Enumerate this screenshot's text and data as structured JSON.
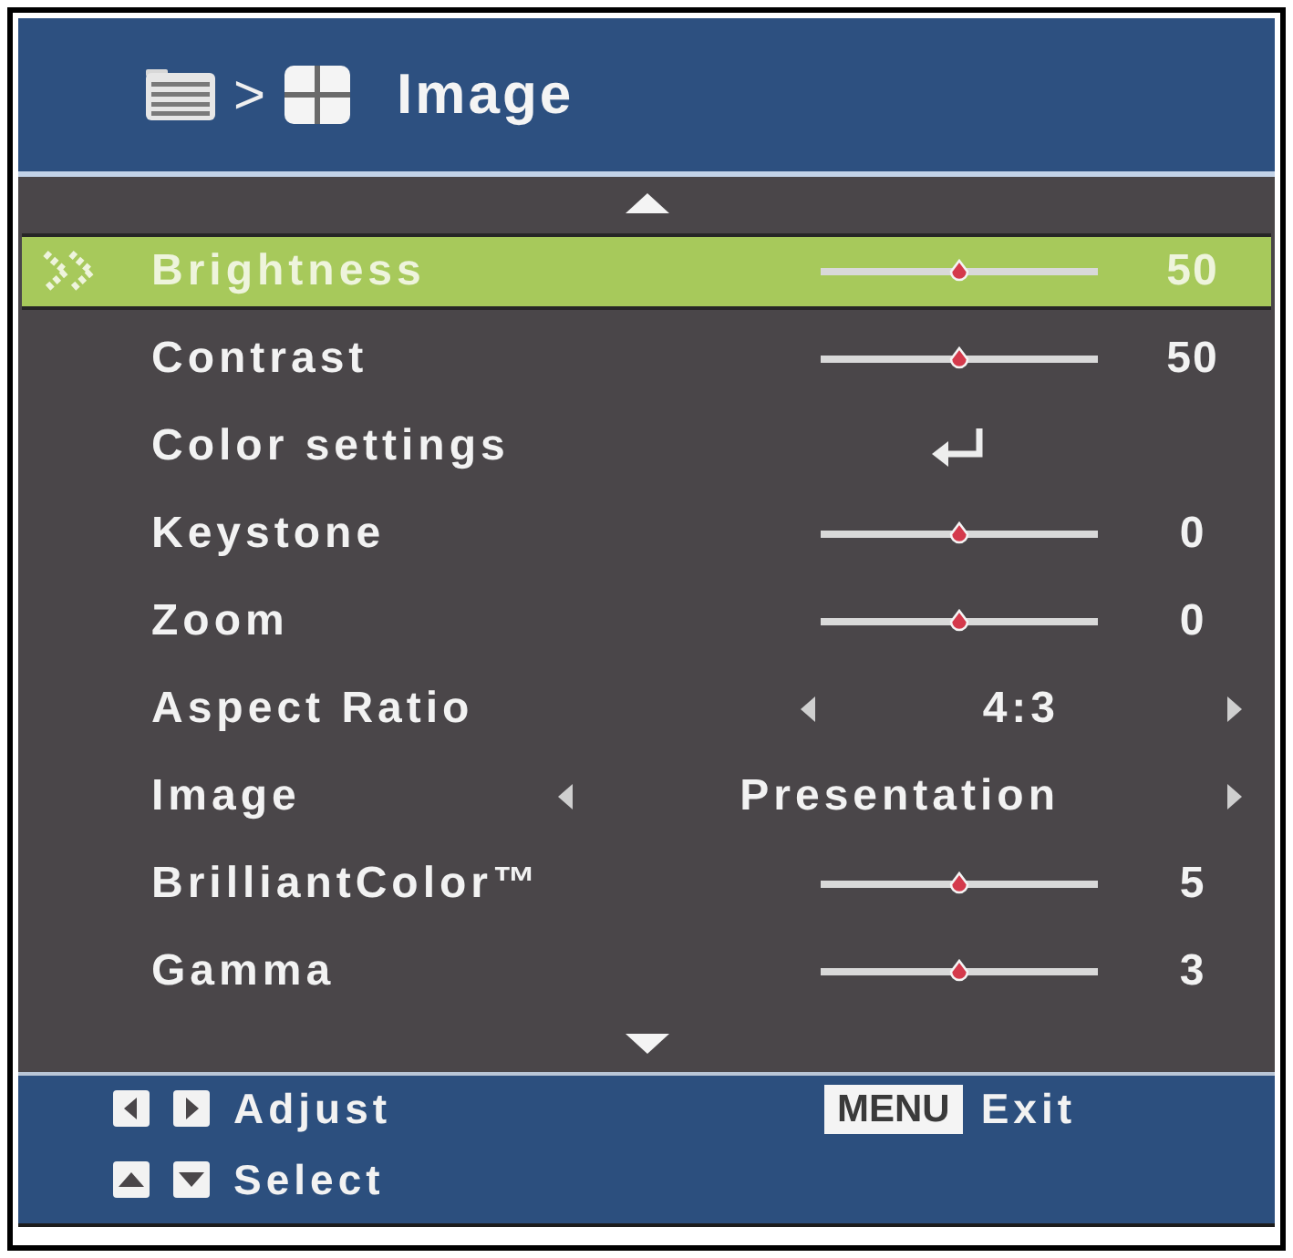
{
  "header": {
    "separator": ">",
    "title": "Image"
  },
  "items": [
    {
      "kind": "slider",
      "label": "Brightness",
      "selected": true,
      "level": 0.5,
      "value": "50"
    },
    {
      "kind": "slider",
      "label": "Contrast",
      "selected": false,
      "level": 0.5,
      "value": "50"
    },
    {
      "kind": "submenu",
      "label": "Color settings",
      "selected": false
    },
    {
      "kind": "slider",
      "label": "Keystone",
      "selected": false,
      "level": 0.5,
      "value": "0"
    },
    {
      "kind": "slider",
      "label": "Zoom",
      "selected": false,
      "level": 0.5,
      "value": "0"
    },
    {
      "kind": "choice",
      "label": "Aspect Ratio",
      "selected": false,
      "value": "4:3"
    },
    {
      "kind": "choice",
      "label": "Image",
      "selected": false,
      "value": "Presentation"
    },
    {
      "kind": "slider",
      "label": "BrilliantColor™",
      "selected": false,
      "level": 0.5,
      "value": "5"
    },
    {
      "kind": "slider",
      "label": "Gamma",
      "selected": false,
      "level": 0.5,
      "value": "3"
    }
  ],
  "footer": {
    "hints": [
      {
        "kind": "left_right",
        "label": "Adjust"
      },
      {
        "kind": "up_down",
        "label": "Select"
      }
    ],
    "exit": {
      "key": "MENU",
      "label": "Exit"
    }
  }
}
